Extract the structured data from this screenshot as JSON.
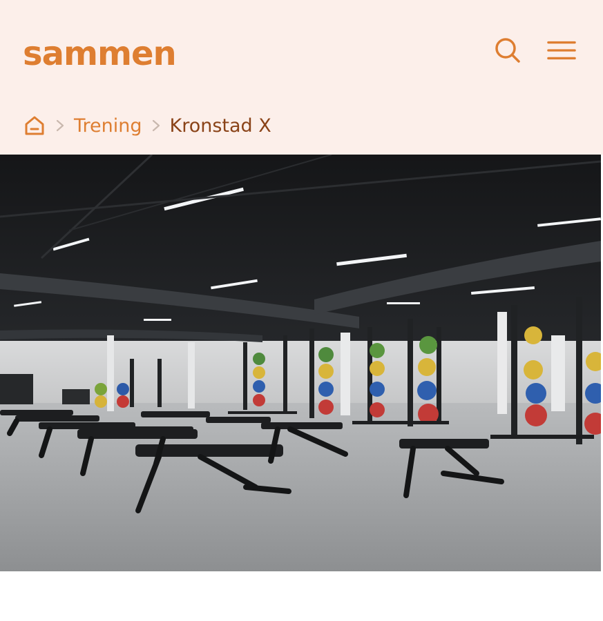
{
  "brand": {
    "logo_text": "sammen",
    "accent_color": "#de7e31",
    "dark_accent_color": "#8a4318",
    "header_bg": "#fcefea"
  },
  "header": {
    "search_icon": "search-icon",
    "menu_icon": "hamburger-menu-icon"
  },
  "breadcrumb": {
    "home_icon": "home-icon",
    "separator_icon": "chevron-right-icon",
    "items": [
      {
        "label": "Trening"
      },
      {
        "label": "Kronstad X"
      }
    ]
  },
  "hero": {
    "image_subject": "gym-interior-photo"
  }
}
